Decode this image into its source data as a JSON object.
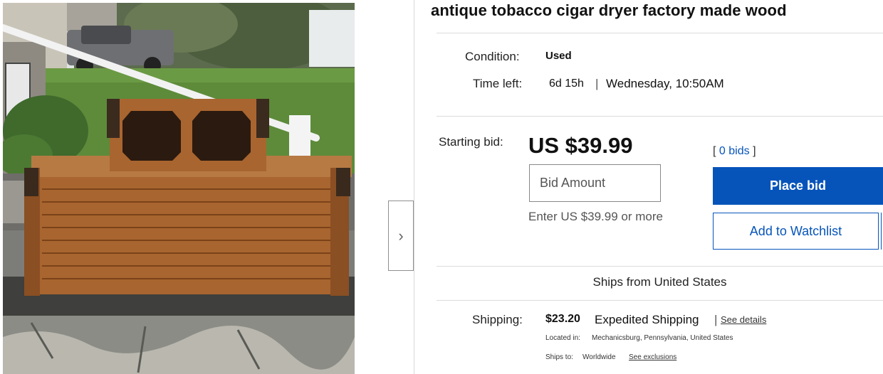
{
  "listing": {
    "title": "antique tobacco cigar dryer factory made wood"
  },
  "details": {
    "condition_label": "Condition:",
    "condition_value": "Used",
    "time_left_label": "Time left:",
    "time_left_value": "6d 15h",
    "time_left_separator": "|",
    "end_time": "Wednesday, 10:50AM"
  },
  "bidding": {
    "starting_bid_label": "Starting bid:",
    "price": "US $39.99",
    "bids_open": "[",
    "bids_link": "0 bids",
    "bids_close": "]",
    "bid_input_placeholder": "Bid Amount",
    "bid_hint": "Enter US $39.99 or more",
    "place_bid_label": "Place bid",
    "watchlist_label": "Add to Watchlist"
  },
  "shipping": {
    "ships_from": "Ships from United States",
    "label": "Shipping:",
    "cost": "$23.20",
    "method": "Expedited Shipping",
    "separator": "|",
    "see_details": "See details",
    "located_label": "Located in:",
    "located_value": "Mechanicsburg, Pennsylvania, United States",
    "ships_to_label": "Ships to:",
    "ships_to_value": "Worldwide",
    "see_exclusions": "See exclusions"
  },
  "gallery": {
    "next_icon": "chevron-right-icon"
  },
  "colors": {
    "accent": "#0654ba",
    "text": "#111111",
    "divider": "#dcdcdc"
  }
}
